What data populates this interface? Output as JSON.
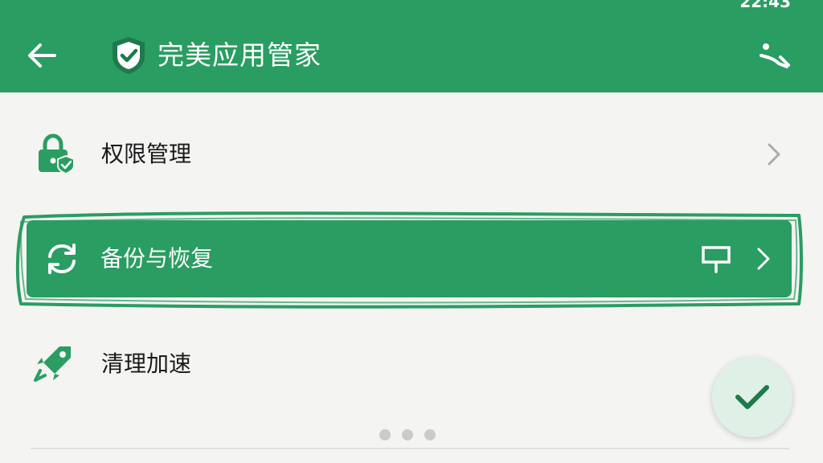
{
  "status_bar": {
    "time_text": "22:43"
  },
  "app_bar": {
    "title": "完美应用管家",
    "back_icon": "arrow-left-icon",
    "logo_icon": "shield-check-icon",
    "action_icon": "broom-icon"
  },
  "list": [
    {
      "label": "权限管理",
      "icon": "lock-shield-icon"
    },
    {
      "label": "备份与恢复",
      "icon": "sync-icon",
      "highlighted": true,
      "trailing_icon": "pin-icon"
    },
    {
      "label": "清理加速",
      "icon": "rocket-icon"
    }
  ],
  "pager": {
    "page_count": 3
  },
  "fab": {
    "icon": "check-icon"
  },
  "colors": {
    "primary": "#2a9d62",
    "background": "#f4f4f2",
    "fab_background": "#dff1e7",
    "text": "#1a1a1a",
    "chevron": "#a9abab"
  }
}
